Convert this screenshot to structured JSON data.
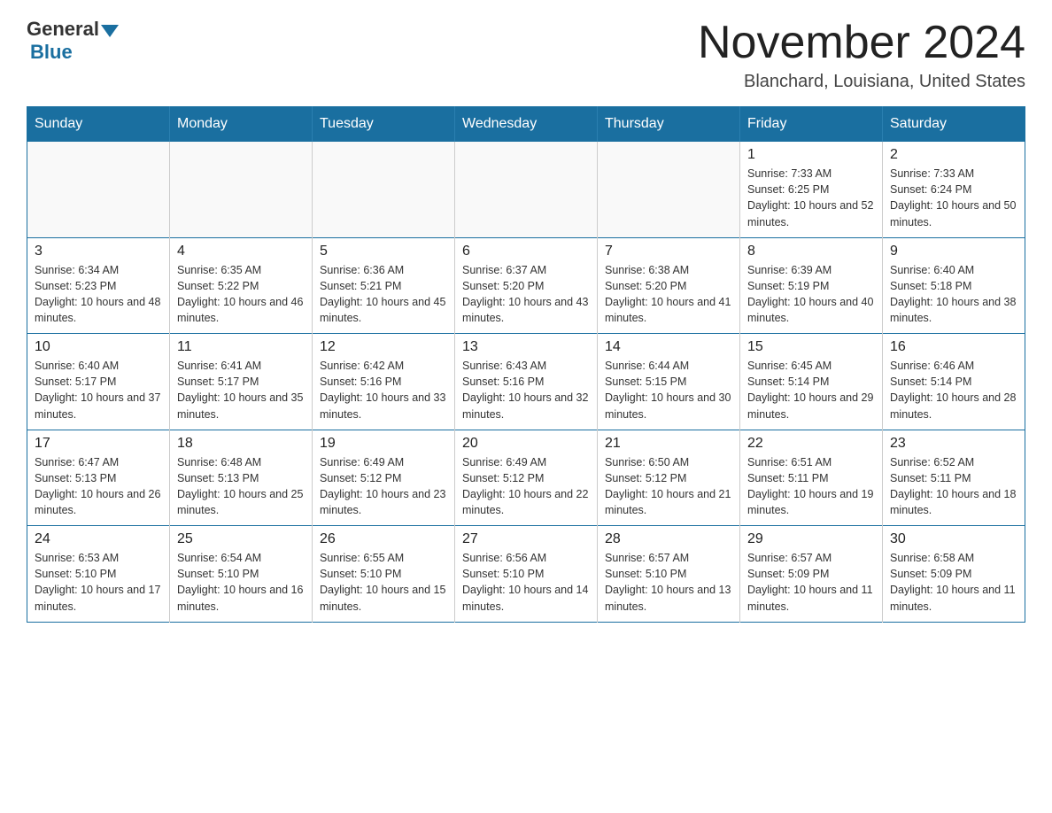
{
  "logo": {
    "general": "General",
    "blue": "Blue"
  },
  "title": "November 2024",
  "subtitle": "Blanchard, Louisiana, United States",
  "days_of_week": [
    "Sunday",
    "Monday",
    "Tuesday",
    "Wednesday",
    "Thursday",
    "Friday",
    "Saturday"
  ],
  "weeks": [
    [
      {
        "day": "",
        "sunrise": "",
        "sunset": "",
        "daylight": ""
      },
      {
        "day": "",
        "sunrise": "",
        "sunset": "",
        "daylight": ""
      },
      {
        "day": "",
        "sunrise": "",
        "sunset": "",
        "daylight": ""
      },
      {
        "day": "",
        "sunrise": "",
        "sunset": "",
        "daylight": ""
      },
      {
        "day": "",
        "sunrise": "",
        "sunset": "",
        "daylight": ""
      },
      {
        "day": "1",
        "sunrise": "Sunrise: 7:33 AM",
        "sunset": "Sunset: 6:25 PM",
        "daylight": "Daylight: 10 hours and 52 minutes."
      },
      {
        "day": "2",
        "sunrise": "Sunrise: 7:33 AM",
        "sunset": "Sunset: 6:24 PM",
        "daylight": "Daylight: 10 hours and 50 minutes."
      }
    ],
    [
      {
        "day": "3",
        "sunrise": "Sunrise: 6:34 AM",
        "sunset": "Sunset: 5:23 PM",
        "daylight": "Daylight: 10 hours and 48 minutes."
      },
      {
        "day": "4",
        "sunrise": "Sunrise: 6:35 AM",
        "sunset": "Sunset: 5:22 PM",
        "daylight": "Daylight: 10 hours and 46 minutes."
      },
      {
        "day": "5",
        "sunrise": "Sunrise: 6:36 AM",
        "sunset": "Sunset: 5:21 PM",
        "daylight": "Daylight: 10 hours and 45 minutes."
      },
      {
        "day": "6",
        "sunrise": "Sunrise: 6:37 AM",
        "sunset": "Sunset: 5:20 PM",
        "daylight": "Daylight: 10 hours and 43 minutes."
      },
      {
        "day": "7",
        "sunrise": "Sunrise: 6:38 AM",
        "sunset": "Sunset: 5:20 PM",
        "daylight": "Daylight: 10 hours and 41 minutes."
      },
      {
        "day": "8",
        "sunrise": "Sunrise: 6:39 AM",
        "sunset": "Sunset: 5:19 PM",
        "daylight": "Daylight: 10 hours and 40 minutes."
      },
      {
        "day": "9",
        "sunrise": "Sunrise: 6:40 AM",
        "sunset": "Sunset: 5:18 PM",
        "daylight": "Daylight: 10 hours and 38 minutes."
      }
    ],
    [
      {
        "day": "10",
        "sunrise": "Sunrise: 6:40 AM",
        "sunset": "Sunset: 5:17 PM",
        "daylight": "Daylight: 10 hours and 37 minutes."
      },
      {
        "day": "11",
        "sunrise": "Sunrise: 6:41 AM",
        "sunset": "Sunset: 5:17 PM",
        "daylight": "Daylight: 10 hours and 35 minutes."
      },
      {
        "day": "12",
        "sunrise": "Sunrise: 6:42 AM",
        "sunset": "Sunset: 5:16 PM",
        "daylight": "Daylight: 10 hours and 33 minutes."
      },
      {
        "day": "13",
        "sunrise": "Sunrise: 6:43 AM",
        "sunset": "Sunset: 5:16 PM",
        "daylight": "Daylight: 10 hours and 32 minutes."
      },
      {
        "day": "14",
        "sunrise": "Sunrise: 6:44 AM",
        "sunset": "Sunset: 5:15 PM",
        "daylight": "Daylight: 10 hours and 30 minutes."
      },
      {
        "day": "15",
        "sunrise": "Sunrise: 6:45 AM",
        "sunset": "Sunset: 5:14 PM",
        "daylight": "Daylight: 10 hours and 29 minutes."
      },
      {
        "day": "16",
        "sunrise": "Sunrise: 6:46 AM",
        "sunset": "Sunset: 5:14 PM",
        "daylight": "Daylight: 10 hours and 28 minutes."
      }
    ],
    [
      {
        "day": "17",
        "sunrise": "Sunrise: 6:47 AM",
        "sunset": "Sunset: 5:13 PM",
        "daylight": "Daylight: 10 hours and 26 minutes."
      },
      {
        "day": "18",
        "sunrise": "Sunrise: 6:48 AM",
        "sunset": "Sunset: 5:13 PM",
        "daylight": "Daylight: 10 hours and 25 minutes."
      },
      {
        "day": "19",
        "sunrise": "Sunrise: 6:49 AM",
        "sunset": "Sunset: 5:12 PM",
        "daylight": "Daylight: 10 hours and 23 minutes."
      },
      {
        "day": "20",
        "sunrise": "Sunrise: 6:49 AM",
        "sunset": "Sunset: 5:12 PM",
        "daylight": "Daylight: 10 hours and 22 minutes."
      },
      {
        "day": "21",
        "sunrise": "Sunrise: 6:50 AM",
        "sunset": "Sunset: 5:12 PM",
        "daylight": "Daylight: 10 hours and 21 minutes."
      },
      {
        "day": "22",
        "sunrise": "Sunrise: 6:51 AM",
        "sunset": "Sunset: 5:11 PM",
        "daylight": "Daylight: 10 hours and 19 minutes."
      },
      {
        "day": "23",
        "sunrise": "Sunrise: 6:52 AM",
        "sunset": "Sunset: 5:11 PM",
        "daylight": "Daylight: 10 hours and 18 minutes."
      }
    ],
    [
      {
        "day": "24",
        "sunrise": "Sunrise: 6:53 AM",
        "sunset": "Sunset: 5:10 PM",
        "daylight": "Daylight: 10 hours and 17 minutes."
      },
      {
        "day": "25",
        "sunrise": "Sunrise: 6:54 AM",
        "sunset": "Sunset: 5:10 PM",
        "daylight": "Daylight: 10 hours and 16 minutes."
      },
      {
        "day": "26",
        "sunrise": "Sunrise: 6:55 AM",
        "sunset": "Sunset: 5:10 PM",
        "daylight": "Daylight: 10 hours and 15 minutes."
      },
      {
        "day": "27",
        "sunrise": "Sunrise: 6:56 AM",
        "sunset": "Sunset: 5:10 PM",
        "daylight": "Daylight: 10 hours and 14 minutes."
      },
      {
        "day": "28",
        "sunrise": "Sunrise: 6:57 AM",
        "sunset": "Sunset: 5:10 PM",
        "daylight": "Daylight: 10 hours and 13 minutes."
      },
      {
        "day": "29",
        "sunrise": "Sunrise: 6:57 AM",
        "sunset": "Sunset: 5:09 PM",
        "daylight": "Daylight: 10 hours and 11 minutes."
      },
      {
        "day": "30",
        "sunrise": "Sunrise: 6:58 AM",
        "sunset": "Sunset: 5:09 PM",
        "daylight": "Daylight: 10 hours and 11 minutes."
      }
    ]
  ]
}
